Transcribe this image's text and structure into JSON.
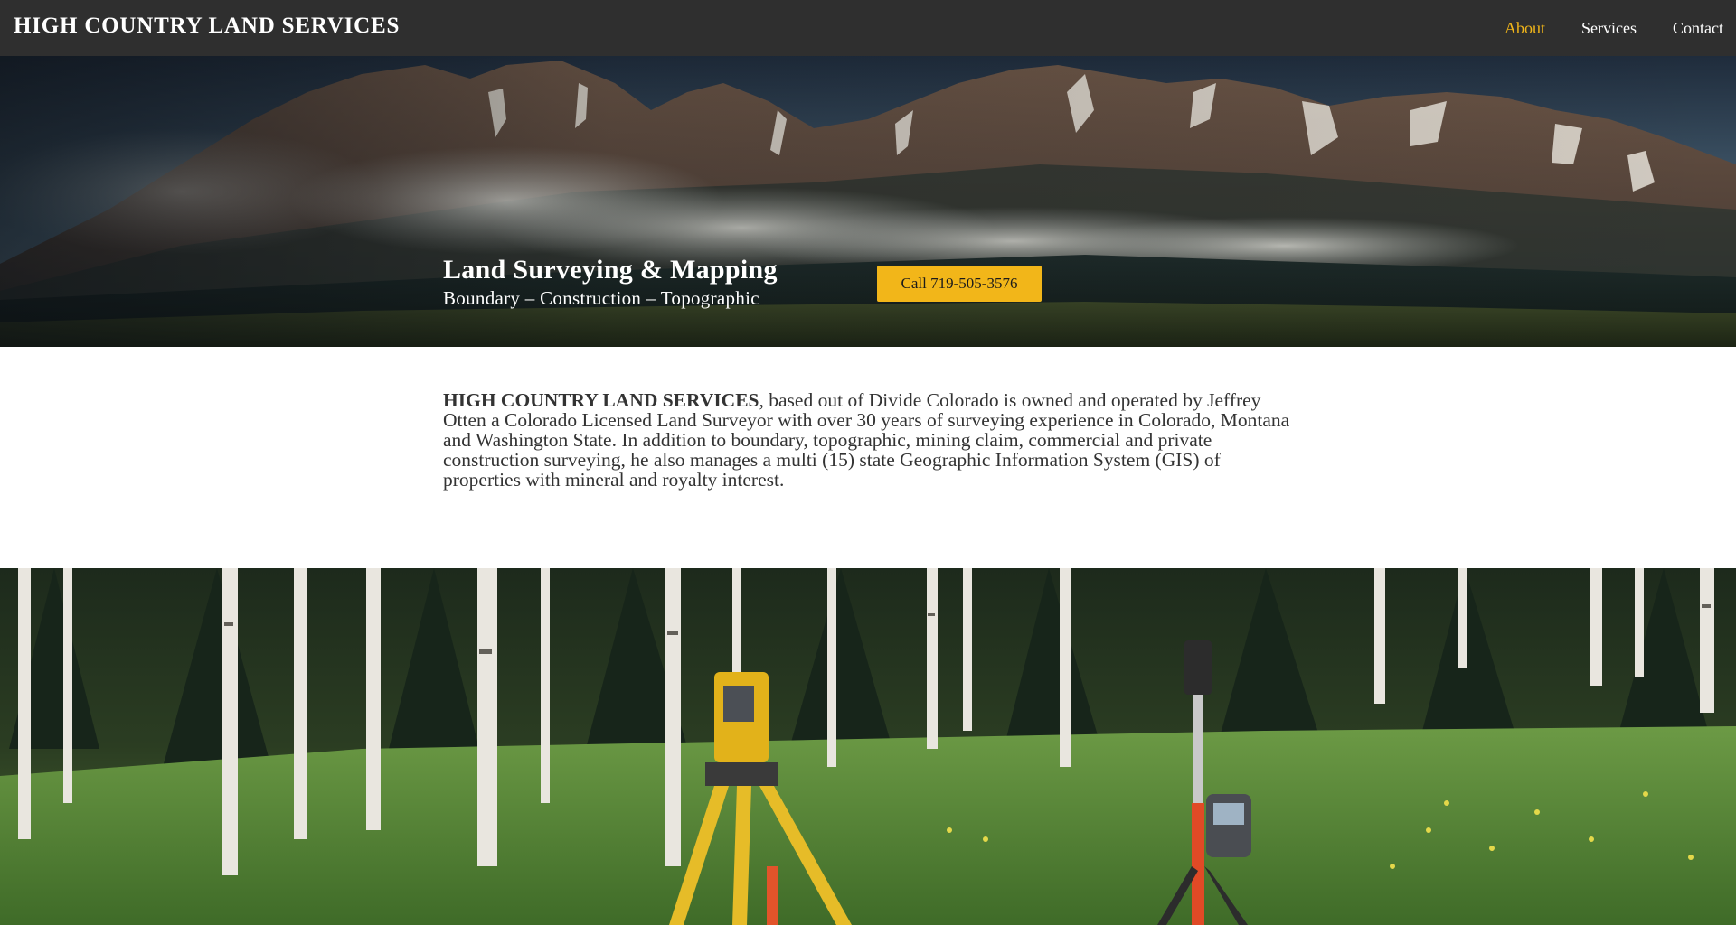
{
  "header": {
    "brand": "HIGH COUNTRY LAND SERVICES",
    "nav": [
      {
        "label": "About",
        "active": true
      },
      {
        "label": "Services",
        "active": false
      },
      {
        "label": "Contact",
        "active": false
      }
    ]
  },
  "hero": {
    "title": "Land Surveying & Mapping",
    "subtitle": "Boundary – Construction – Topographic",
    "call_button": "Call 719-505-3576"
  },
  "about": {
    "company": "HIGH COUNTRY LAND SERVICES",
    "body": ", based out of Divide Colorado is owned and operated by Jeffrey Otten a Colorado Licensed Land Surveyor with over 30 years of surveying experience in Colorado, Montana and Washington State. In addition to boundary, topographic, mining claim, commercial and private construction surveying, he also manages a multi (15) state Geographic Information System (GIS) of properties with mineral and royalty interest."
  },
  "colors": {
    "navbar_bg": "#2f2f2f",
    "accent": "#f2b619",
    "text": "#333333"
  },
  "images": {
    "hero": "mountain-landscape-photo",
    "field": "survey-equipment-in-aspen-forest-photo"
  }
}
